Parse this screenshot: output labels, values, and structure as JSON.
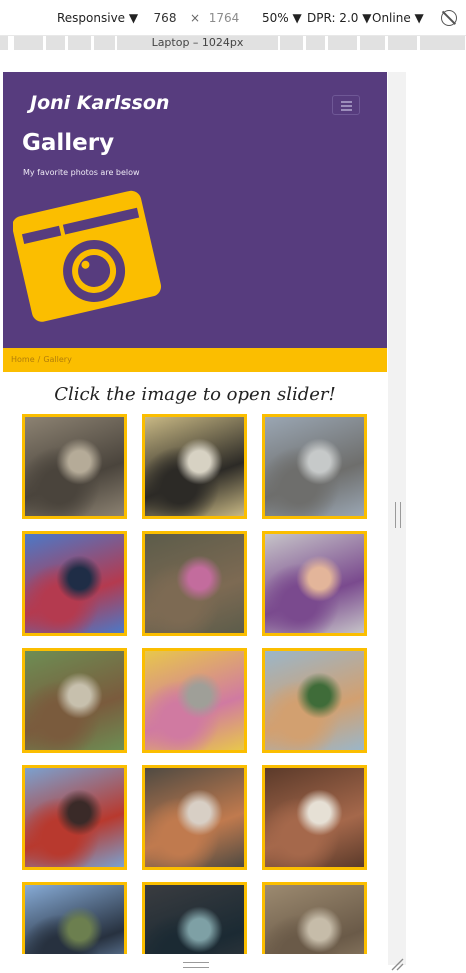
{
  "devtools": {
    "device": "Responsive",
    "width": "768",
    "height": "1764",
    "times": "×",
    "zoom": "50%",
    "dpr": "DPR: 2.0",
    "network": "Online",
    "ruler_label": "Laptop – 1024px"
  },
  "site": {
    "name": "Joni Karlsson",
    "title": "Gallery",
    "subtitle": "My favorite photos are below",
    "brand_color": "#573c7e",
    "accent_color": "#fbbe00"
  },
  "breadcrumb": {
    "home": "Home",
    "separator": "/",
    "current": "Gallery"
  },
  "gallery": {
    "intro": "Click the image to open slider!",
    "photos": [
      {
        "name": "photo-man-sitting-on-rocks",
        "c1": "#8c8272",
        "c2": "#4a443c",
        "c3": "#b5ab98"
      },
      {
        "name": "photo-man-in-cap-eating",
        "c1": "#c8b884",
        "c2": "#2c2a26",
        "c3": "#d7d2c3"
      },
      {
        "name": "photo-kids-on-path",
        "c1": "#9aa6b3",
        "c2": "#6e6e6c",
        "c3": "#c6c9c9"
      },
      {
        "name": "photo-family-in-boat",
        "c1": "#4b79c8",
        "c2": "#b43a4f",
        "c3": "#1f2d46"
      },
      {
        "name": "photo-kids-in-forest",
        "c1": "#5c5c4a",
        "c2": "#7d6a53",
        "c3": "#c36c9d"
      },
      {
        "name": "photo-baby-on-blanket",
        "c1": "#c6c4c8",
        "c2": "#7a4a8e",
        "c3": "#e3b59a"
      },
      {
        "name": "photo-child-on-swing",
        "c1": "#6d8e54",
        "c2": "#7a5b3d",
        "c3": "#c7c0ad"
      },
      {
        "name": "photo-kids-in-hallway",
        "c1": "#e8c74b",
        "c2": "#d07aa1",
        "c3": "#9f9f98"
      },
      {
        "name": "photo-selfie-couple",
        "c1": "#9ab6c9",
        "c2": "#d2a070",
        "c3": "#3f6c39"
      },
      {
        "name": "photo-woman-in-boat",
        "c1": "#7ba1cf",
        "c2": "#b8392e",
        "c3": "#3a2a28"
      },
      {
        "name": "photo-woman-with-banknote",
        "c1": "#4f4a42",
        "c2": "#c07a4e",
        "c3": "#d8cfc5"
      },
      {
        "name": "photo-woman-drinking-coffee",
        "c1": "#5b3a2a",
        "c2": "#a5684b",
        "c3": "#e6e0d5"
      },
      {
        "name": "photo-man-in-boat-lake",
        "c1": "#87abd6",
        "c2": "#27313f",
        "c3": "#6c7f4f"
      },
      {
        "name": "photo-laptop-screen",
        "c1": "#3a3c40",
        "c2": "#1b2a33",
        "c3": "#7ea0a5"
      },
      {
        "name": "photo-wooden-deck",
        "c1": "#9c8a70",
        "c2": "#6a5a48",
        "c3": "#c6bca9"
      }
    ]
  }
}
